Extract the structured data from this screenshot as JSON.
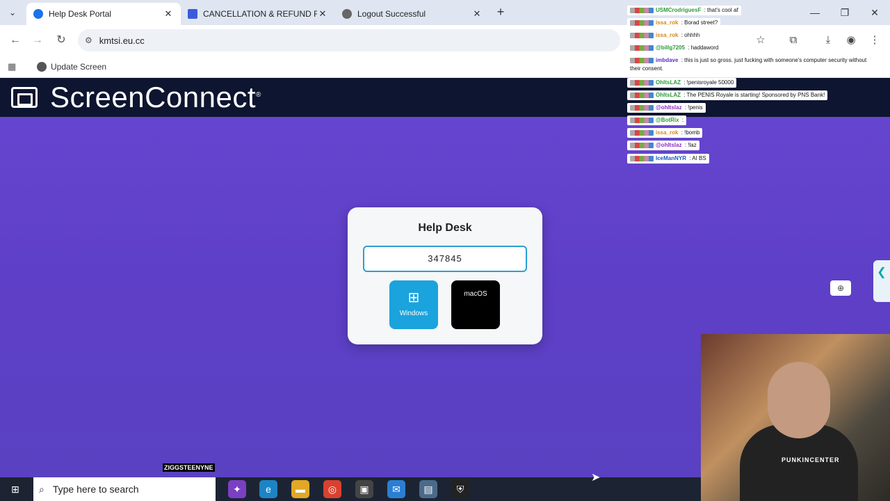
{
  "browser": {
    "tabs": [
      {
        "title": "Help Desk Portal",
        "color": "#1a73e8"
      },
      {
        "title": "CANCELLATION & REFUND FO",
        "color": "#3b5bdb"
      },
      {
        "title": "Logout Successful",
        "color": "#666666"
      }
    ],
    "url": "kmtsi.eu.cc",
    "bookmark": "Update Screen"
  },
  "page": {
    "brand": "ScreenConnect",
    "brand_mark": "®",
    "card_title": "Help Desk",
    "code": "347845",
    "buttons": {
      "windows": "Windows",
      "macos": "macOS"
    }
  },
  "chat": [
    {
      "user": "USMCrodriguesF",
      "text": " : that's cool af",
      "color": "#2e9a3a"
    },
    {
      "user": "issa_rok",
      "text": " : Borad street?",
      "color": "#d4891a"
    },
    {
      "user": "issa_rok",
      "text": " : ohhhh",
      "color": "#d4891a"
    },
    {
      "user": "@billg7205",
      "text": " : haddaword",
      "color": "#2e9a3a"
    },
    {
      "user": "imbdave",
      "text": " : this is just so gross. just fucking with someone's computer security without their consent.",
      "color": "#5a2fc4"
    },
    {
      "user": "OhItsLAZ",
      "text": " : !penisroyale 50000",
      "color": "#2e9a3a"
    },
    {
      "user": "OhItsLAZ",
      "text": " : The PENIS Royale is starting! Sponsored by PNS Bank!",
      "color": "#2e9a3a"
    },
    {
      "user": "@ohItslaz",
      "text": " : !penis",
      "color": "#8a2fc4"
    },
    {
      "user": "@BotRix",
      "text": " : ",
      "color": "#2e9a3a"
    },
    {
      "user": "issa_rok",
      "text": " : !bomb",
      "color": "#d4891a"
    },
    {
      "user": "@ohItslaz",
      "text": " : !laz",
      "color": "#8a2fc4"
    },
    {
      "user": "IceManNYR",
      "text": " : AI BS",
      "color": "#1a58c4"
    }
  ],
  "overlay": {
    "webcam_name": "PUNKINCENTER",
    "taskbar_name": "ZIGGSTEENYNE"
  },
  "taskbar": {
    "search_placeholder": "Type here to search"
  }
}
